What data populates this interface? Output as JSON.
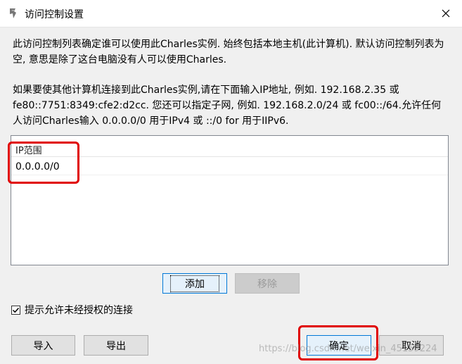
{
  "window": {
    "title": "访问控制设置",
    "close_label": "×"
  },
  "description": {
    "para1": "此访问控制列表确定谁可以使用此Charles实例. 始终包括本地主机(此计算机). 默认访问控制列表为空, 意思是除了这台电脑没有人可以使用Charles.",
    "para2": "如果要使其他计算机连接到此Charles实例,请在下面输入IP地址, 例如. 192.168.2.35 或 fe80::7751:8349:cfe2:d2cc. 您还可以指定子网, 例如. 192.168.2.0/24 或 fc00::/64.允许任何人访问Charles输入 0.0.0.0/0 用于IPv4 或 ::/0 for 用于IIPv6."
  },
  "ip_table": {
    "header": "IP范围",
    "rows": [
      "0.0.0.0/0"
    ]
  },
  "buttons": {
    "add": "添加",
    "remove": "移除",
    "import": "导入",
    "export": "导出",
    "ok": "确定",
    "cancel": "取消"
  },
  "checkbox": {
    "label": "提示允许未经授权的连接",
    "checked": true
  },
  "watermark": "https://blog.csdn.net/weixin_45159224",
  "colors": {
    "annotation": "#e00000",
    "default_button_border": "#0078d7"
  }
}
